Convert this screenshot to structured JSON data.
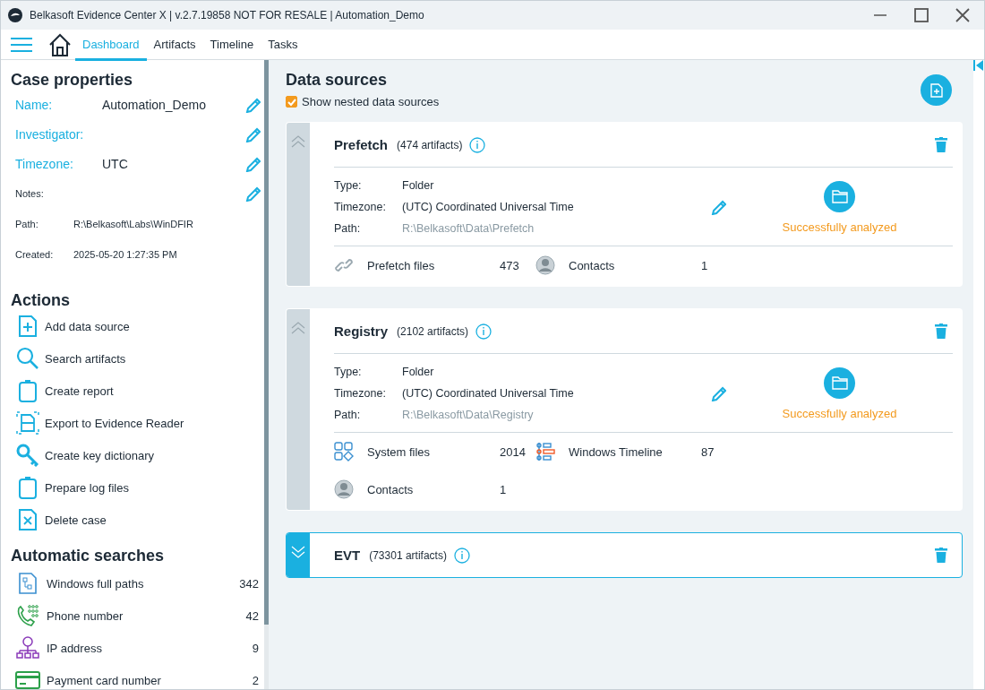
{
  "window": {
    "title": "Belkasoft Evidence Center X | v.2.7.19858 NOT FOR RESALE | Automation_Demo"
  },
  "tabs": [
    {
      "label": "Dashboard",
      "selected": true
    },
    {
      "label": "Artifacts",
      "selected": false
    },
    {
      "label": "Timeline",
      "selected": false
    },
    {
      "label": "Tasks",
      "selected": false
    }
  ],
  "case_properties": {
    "title": "Case properties",
    "fields": [
      {
        "label": "Name:",
        "value": "Automation_Demo",
        "kind": "primary",
        "editable": true
      },
      {
        "label": "Investigator:",
        "kind": "primary",
        "editable": true
      },
      {
        "label": "Timezone:",
        "value": "UTC",
        "kind": "primary",
        "editable": true
      },
      {
        "label": "Notes:",
        "kind": "secondary",
        "editable": true
      },
      {
        "label": "Path:",
        "value": "R:\\Belkasoft\\Labs\\WinDFIR",
        "kind": "secondary",
        "editable": false
      },
      {
        "label": "Created:",
        "value": "2025-05-20 1:27:35 PM",
        "kind": "secondary",
        "editable": false
      }
    ]
  },
  "actions": {
    "title": "Actions",
    "items": [
      {
        "label": "Add data source",
        "kind": "add"
      },
      {
        "label": "Search artifacts",
        "kind": "search"
      },
      {
        "label": "Create report",
        "kind": "clipboard"
      },
      {
        "label": "Export to Evidence Reader",
        "kind": "export"
      },
      {
        "label": "Create key dictionary",
        "kind": "key"
      },
      {
        "label": "Prepare log files",
        "kind": "clipboard"
      },
      {
        "label": "Delete case",
        "kind": "delete"
      }
    ]
  },
  "automatic_searches": {
    "title": "Automatic searches",
    "items": [
      {
        "label": "Windows full paths",
        "count": "342",
        "kind": "paths"
      },
      {
        "label": "Phone number",
        "count": "42",
        "kind": "phone"
      },
      {
        "label": "IP address",
        "count": "9",
        "kind": "ip"
      },
      {
        "label": "Payment card number",
        "count": "2",
        "kind": "card"
      }
    ]
  },
  "data_sources": {
    "title": "Data sources",
    "show_nested": {
      "label": "Show nested data sources",
      "checked": true
    },
    "items": [
      {
        "name": "Prefetch",
        "artifacts": "(474 artifacts)",
        "expanded": true,
        "selected": false,
        "type_label": "Type:",
        "type": "Folder",
        "timezone_label": "Timezone:",
        "timezone": "(UTC) Coordinated Universal Time",
        "path_label": "Path:",
        "path": "R:\\Belkasoft\\Data\\Prefetch",
        "status": "Successfully analyzed",
        "stats": [
          {
            "label": "Prefetch files",
            "count": "473",
            "kind": "link"
          },
          {
            "label": "Contacts",
            "count": "1",
            "kind": "contacts"
          }
        ]
      },
      {
        "name": "Registry",
        "artifacts": "(2102 artifacts)",
        "expanded": true,
        "selected": false,
        "type_label": "Type:",
        "type": "Folder",
        "timezone_label": "Timezone:",
        "timezone": "(UTC) Coordinated Universal Time",
        "path_label": "Path:",
        "path": "R:\\Belkasoft\\Data\\Registry",
        "status": "Successfully analyzed",
        "stats": [
          {
            "label": "System files",
            "count": "2014",
            "kind": "system"
          },
          {
            "label": "Windows Timeline",
            "count": "87",
            "kind": "timeline"
          },
          {
            "label": "Contacts",
            "count": "1",
            "kind": "contacts"
          }
        ]
      },
      {
        "name": "EVT",
        "artifacts": "(73301 artifacts)",
        "expanded": false,
        "selected": true
      }
    ]
  }
}
